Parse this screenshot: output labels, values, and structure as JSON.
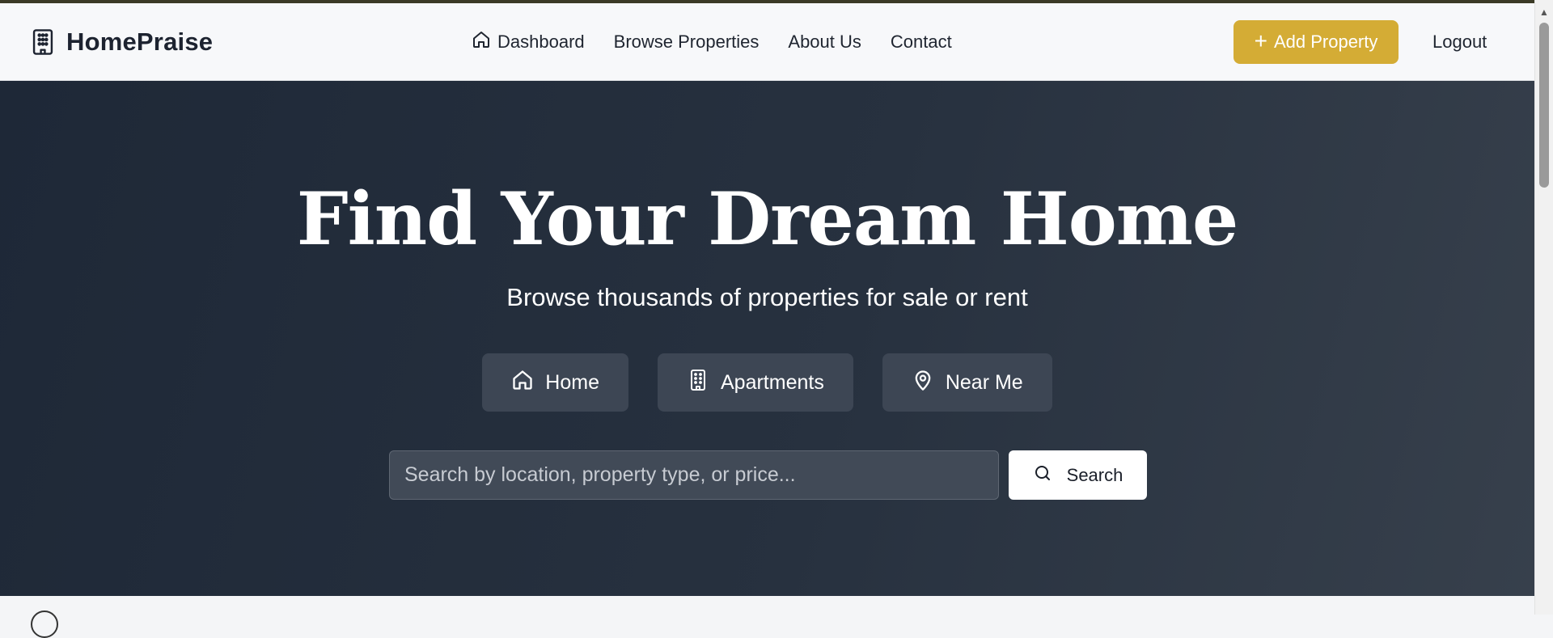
{
  "brand": {
    "name": "HomePraise",
    "icon": "building-icon"
  },
  "nav": {
    "links": [
      {
        "label": "Dashboard",
        "icon": "home-icon"
      },
      {
        "label": "Browse Properties"
      },
      {
        "label": "About Us"
      },
      {
        "label": "Contact"
      }
    ],
    "add_property_label": "Add Property",
    "logout_label": "Logout"
  },
  "hero": {
    "title": "Find Your Dream Home",
    "subtitle": "Browse thousands of properties for sale or rent",
    "chips": [
      {
        "label": "Home",
        "icon": "home-icon"
      },
      {
        "label": "Apartments",
        "icon": "building-icon"
      },
      {
        "label": "Near Me",
        "icon": "map-pin-icon"
      }
    ],
    "search": {
      "placeholder": "Search by location, property type, or price...",
      "value": "",
      "button_label": "Search"
    }
  },
  "colors": {
    "accent": "#d4ac35",
    "hero_start": "#1e2837",
    "hero_end": "#37404c",
    "navbar_bg": "#f7f8fa"
  }
}
